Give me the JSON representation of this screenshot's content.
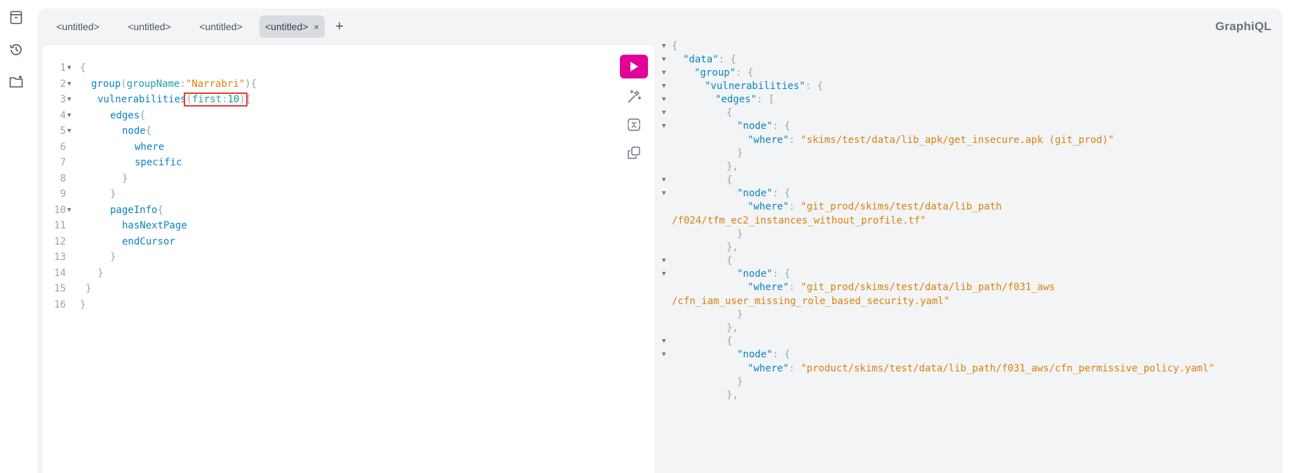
{
  "sidebar": {
    "icons": [
      "docs-icon",
      "history-icon",
      "explorer-icon"
    ]
  },
  "tabs": [
    {
      "label": "<untitled>"
    },
    {
      "label": "<untitled>"
    },
    {
      "label": "<untitled>"
    },
    {
      "label": "<untitled>",
      "close": "×"
    }
  ],
  "add_tab_label": "+",
  "brand": "GraphiQL",
  "editor": {
    "line_numbers": [
      "1",
      "2",
      "3",
      "4",
      "5",
      "6",
      "7",
      "8",
      "9",
      "10",
      "11",
      "12",
      "13",
      "14",
      "15",
      "16"
    ],
    "query": {
      "l1": "{",
      "l2_field": "group",
      "l2_arg": "groupName",
      "l2_val": "\"Narrabri\"",
      "l3_field": "vulnerabilities",
      "l3_arg": "first",
      "l3_val": "10",
      "l4": "edges",
      "l5": "node",
      "l6": "where",
      "l7": "specific",
      "l10": "pageInfo",
      "l11": "hasNextPage",
      "l12": "endCursor"
    }
  },
  "result": {
    "k_data": "\"data\"",
    "k_group": "\"group\"",
    "k_vulns": "\"vulnerabilities\"",
    "k_edges": "\"edges\"",
    "k_node": "\"node\"",
    "k_where": "\"where\"",
    "v1": "\"skims/test/data/lib_apk/get_insecure.apk (git_prod)\"",
    "v2a": "\"git_prod/skims/test/data/lib_path",
    "v2b": "/f024/tfm_ec2_instances_without_profile.tf\"",
    "v3a": "\"git_prod/skims/test/data/lib_path/f031_aws",
    "v3b": "/cfn_iam_user_missing_role_based_security.yaml\"",
    "v4": "\"product/skims/test/data/lib_path/f031_aws/cfn_permissive_policy.yaml\""
  },
  "colors": {
    "accent": "#e10098",
    "highlight_box": "#e53935"
  }
}
